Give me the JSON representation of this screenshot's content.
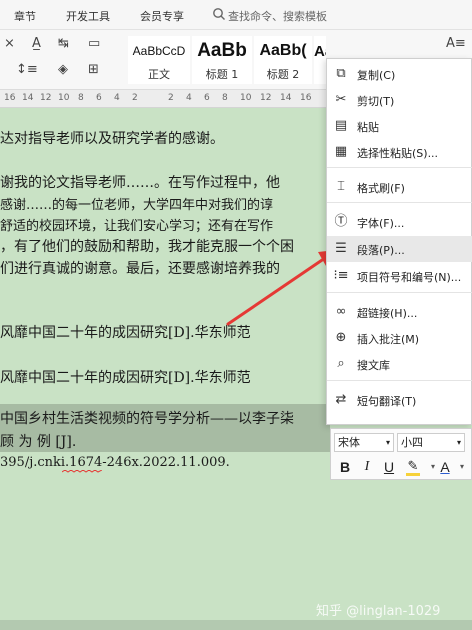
{
  "menubar": {
    "items": [
      "章节",
      "开发工具",
      "会员专享"
    ],
    "search_placeholder": "查找命令、搜索模板"
  },
  "ribbon": {
    "styles": [
      {
        "sample": "AaBbCcD",
        "label": "正文"
      },
      {
        "sample": "AaBb",
        "label": "标题 1"
      },
      {
        "sample": "AaBb(",
        "label": "标题 2"
      },
      {
        "sample": "AaBbC",
        "label": ""
      }
    ]
  },
  "ruler": {
    "numbers": [
      "16",
      "14",
      "12",
      "10",
      "8",
      "6",
      "4",
      "2",
      "",
      "2",
      "4",
      "6",
      "8",
      "10",
      "12",
      "14",
      "16"
    ]
  },
  "document": {
    "lines": [
      "达对指导老师以及研究学者的感谢。",
      "谢我的论文指导老师……。在写作过程中，他",
      "感谢……的每一位老师，大学四年中对我们的谆",
      "舒适的校园环境，让我们安心学习；还有在写作",
      "，有了他们的鼓励和帮助，我才能克服一个个困",
      "们进行真诚的谢意。最后，还要感谢培养我的",
      "风靡中国二十年的成因研究[D].华东师范",
      "风靡中国二十年的成因研究[D].华东师范",
      "中国乡村生活类视频的符号学分析——以李子柒",
      "顾          为          例          [J].",
      "395/j.cnki.1674-246x.2022.11.009."
    ]
  },
  "context_menu": {
    "items": [
      {
        "label": "复制(C)",
        "icon": "copy-icon"
      },
      {
        "label": "剪切(T)",
        "icon": "scissors-icon"
      },
      {
        "label": "粘贴",
        "icon": "paste-icon"
      },
      {
        "label": "选择性粘贴(S)...",
        "icon": "paste-special-icon"
      },
      {
        "label": "格式刷(F)",
        "icon": "format-brush-icon"
      },
      {
        "label": "字体(F)...",
        "icon": "font-icon"
      },
      {
        "label": "段落(P)...",
        "icon": "paragraph-icon"
      },
      {
        "label": "项目符号和编号(N)...",
        "icon": "bullet-list-icon"
      },
      {
        "label": "超链接(H)...",
        "icon": "hyperlink-icon"
      },
      {
        "label": "插入批注(M)",
        "icon": "insert-comment-icon"
      },
      {
        "label": "搜文库",
        "icon": "search-library-icon"
      },
      {
        "label": "短句翻译(T)",
        "icon": "translate-icon"
      }
    ],
    "highlighted_index": 6
  },
  "mini_toolbar": {
    "font": "宋体",
    "size": "小四",
    "buttons": [
      "B",
      "I",
      "U",
      "A"
    ]
  },
  "watermark": {
    "text": "知乎 @linglan-1029"
  },
  "colors": {
    "page_background": "#c9e2c5",
    "selection": "#a7bba3",
    "arrow": "#e53935",
    "highlight_yellow": "#f7d23a",
    "font_color_blue": "#2f5fd0"
  }
}
